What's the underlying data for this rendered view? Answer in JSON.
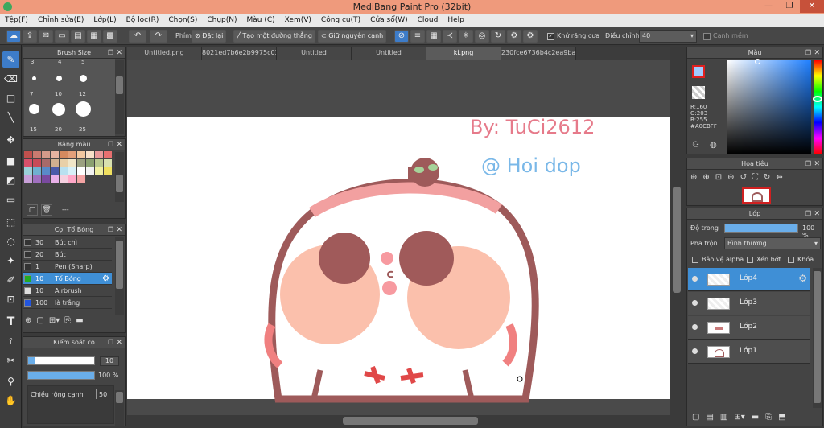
{
  "app": {
    "title": "MediBang Paint Pro (32bit)"
  },
  "window_controls": {
    "minimize": "—",
    "maximize": "❐",
    "close": "✕"
  },
  "menu": [
    "Tệp(F)",
    "Chỉnh sửa(E)",
    "Lớp(L)",
    "Bộ lọc(R)",
    "Chọn(S)",
    "Chụp(N)",
    "Màu (C)",
    "Xem(V)",
    "Công cụ(T)",
    "Cửa sổ(W)",
    "Cloud",
    "Help"
  ],
  "toolbar": {
    "phim_label": "Phím",
    "reset_label": "Đặt lại",
    "straight_label": "Tạo một đường thẳng",
    "keep_edge_label": "Giữ nguyên cạnh",
    "antialias_label": "Khử răng cưa",
    "adjust_label": "Điều chỉnh",
    "adjust_value": "40",
    "smooth_edge_label": "Cạnh mềm"
  },
  "brush_size": {
    "title": "Brush Size",
    "sizes": [
      "3",
      "4",
      "5",
      "7",
      "10",
      "12",
      "15",
      "20",
      "25"
    ]
  },
  "palette": {
    "title": "Bảng màu",
    "footer_text": "---",
    "colors": [
      "#c0504d",
      "#c97a6f",
      "#d49a8a",
      "#e3b2a0",
      "#d48a5f",
      "#e2a07a",
      "#f2c8a0",
      "#f7e0c8",
      "#e89a9a",
      "#e87070",
      "#d8506a",
      "#c84a58",
      "#a86a6a",
      "#d0b090",
      "#e8d0a8",
      "#f0e6c8",
      "#9aa080",
      "#8aa070",
      "#b8c890",
      "#d8e0b0",
      "#9ad0d8",
      "#70b0d0",
      "#5a8ac8",
      "#4a5aa8",
      "#b8e0f0",
      "#d8f0f8",
      "#ffffff",
      "#f2f2f2",
      "#f0f0a0",
      "#f0e060",
      "#c8a0d8",
      "#a070c0",
      "#7a4aa0",
      "#e8b0e8",
      "#f5d0e0",
      "#ffa8c8",
      "#f4a4a4"
    ]
  },
  "brush_panel": {
    "title": "Cọ: Tổ Bóng",
    "brushes": [
      {
        "size": "30",
        "name": "Bút chì",
        "color": "#333333"
      },
      {
        "size": "20",
        "name": "Bút",
        "color": "#333333"
      },
      {
        "size": "1",
        "name": "Pen (Sharp)",
        "color": "#333333"
      },
      {
        "size": "10",
        "name": "Tố Bóng",
        "color": "#22aa22"
      },
      {
        "size": "10",
        "name": "Airbrush",
        "color": "#dddddd"
      },
      {
        "size": "100",
        "name": "là trắng",
        "color": "#2255dd"
      }
    ]
  },
  "brush_control": {
    "title": "Kiểm soát cọ",
    "size_value": "10",
    "opacity_value": "100 %",
    "width_label": "Chiều rộng cạnh",
    "width_value": "50",
    "size_level": 0.1,
    "opacity_level": 1.0
  },
  "tabs": [
    "Untitled.png",
    "8021ed7b6e2b9975c03a.jpg",
    "Untitled",
    "Untitled",
    "kí.png",
    "230fce6736b4c2ea9ba5.jpg"
  ],
  "canvas": {
    "signature_line1": "By: TuCi2612",
    "signature_line2": "@ Hoi dop",
    "accent_pink": "#e67a8a",
    "accent_blue": "#7ab8e8"
  },
  "color_panel": {
    "title": "Màu",
    "r": "R:160",
    "g": "G:203",
    "b": "B:255",
    "hex": "#A0CBFF"
  },
  "navigator": {
    "title": "Hoa tiêu"
  },
  "layer_panel": {
    "title": "Lớp",
    "opacity_label": "Độ trong",
    "opacity_value": "100 %",
    "opacity_level": 1.0,
    "blend_label": "Pha trộn",
    "blend_value": "Bình thường",
    "protect_alpha": "Bảo vệ alpha",
    "clipping": "Xén bớt",
    "lock": "Khóa",
    "layers": [
      "Lớp4",
      "Lớp3",
      "Lớp2",
      "Lớp1"
    ]
  }
}
